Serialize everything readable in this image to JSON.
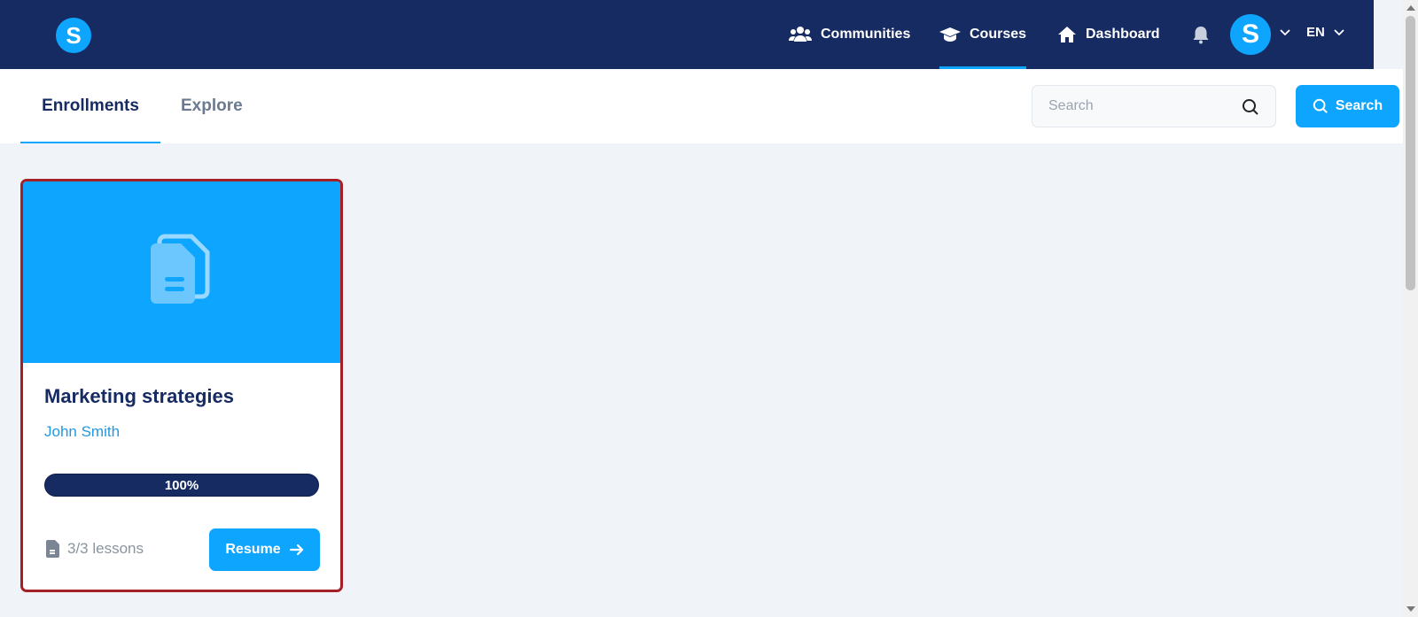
{
  "topnav": {
    "logo_letter": "S",
    "communities_label": "Communities",
    "courses_label": "Courses",
    "dashboard_label": "Dashboard",
    "avatar_letter": "S",
    "lang_label": "EN"
  },
  "tabs": {
    "enrollments_label": "Enrollments",
    "explore_label": "Explore"
  },
  "search": {
    "placeholder": "Search",
    "value": "",
    "button_label": "Search"
  },
  "course_card": {
    "title": "Marketing strategies",
    "author": "John Smith",
    "progress_label": "100%",
    "progress_percent": 100,
    "lessons_label": "3/3 lessons",
    "resume_label": "Resume"
  },
  "colors": {
    "nav_bg": "#172b63",
    "accent": "#0ea5ff",
    "card_border": "#a52026",
    "page_bg": "#f0f3f8"
  },
  "icons": {
    "communities": "users-icon",
    "courses": "graduation-cap-icon",
    "dashboard": "home-icon",
    "notifications": "bell-icon",
    "search": "magnifier-icon",
    "card_media": "documents-icon",
    "lessons": "document-icon",
    "resume": "arrow-right-icon"
  }
}
